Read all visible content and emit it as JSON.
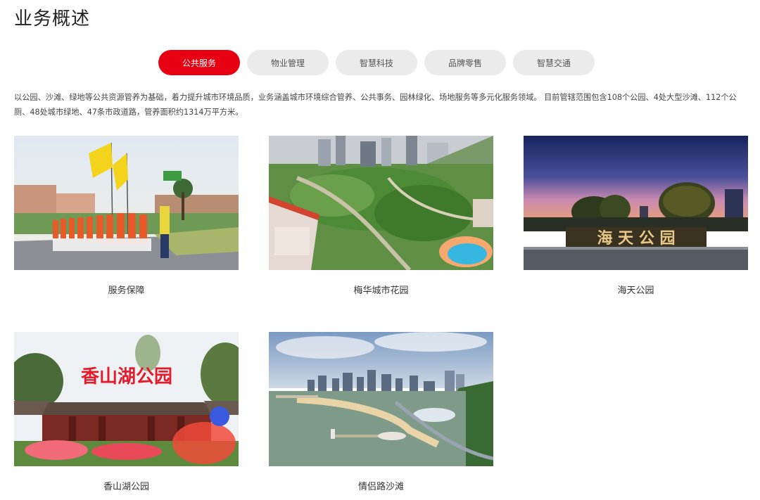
{
  "page": {
    "title": "业务概述"
  },
  "tabs": [
    {
      "label": "公共服务",
      "active": true
    },
    {
      "label": "物业管理",
      "active": false
    },
    {
      "label": "智慧科技",
      "active": false
    },
    {
      "label": "品牌零售",
      "active": false
    },
    {
      "label": "智慧交通",
      "active": false
    }
  ],
  "intro": "以公园、沙滩、绿地等公共资源管养为基础，着力提升城市环境品质，业务涵盖城市环境综合管养、公共事务、园林绿化、场地服务等多元化服务领域。 目前管辖范围包含108个公园、4处大型沙滩、112个公厕、48处城市绿地、47条市政道路，管养面积约1314万平方米。",
  "cards": [
    {
      "caption": "服务保障"
    },
    {
      "caption": "梅华城市花园"
    },
    {
      "caption": "海天公园",
      "sign_text": "海 天 公 园"
    },
    {
      "caption": "香山湖公园",
      "sign_text": "香山湖公园"
    },
    {
      "caption": "情侣路沙滩"
    }
  ],
  "colors": {
    "accent": "#e60012",
    "tab_bg": "#ebebeb"
  }
}
